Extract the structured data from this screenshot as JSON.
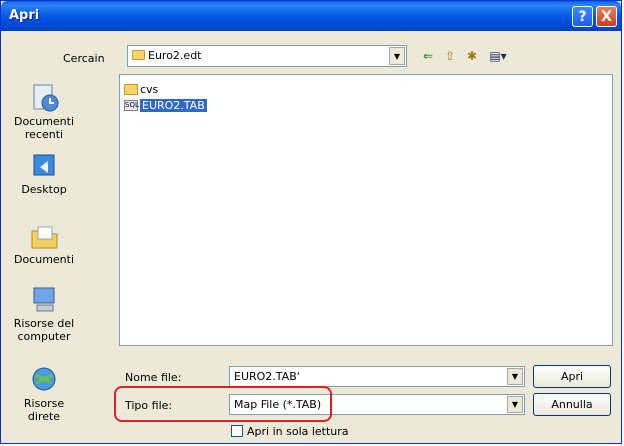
{
  "window": {
    "title": "Apri"
  },
  "titlebar": {
    "help": "?",
    "close": "X"
  },
  "lookin": {
    "label": "Cercain",
    "value": "Euro2.edt"
  },
  "toolbar": {
    "back": "⇐",
    "up": "⇧",
    "new_folder": "✱",
    "views": "▤▾"
  },
  "places": [
    {
      "label": "Documenti recenti"
    },
    {
      "label": "Desktop"
    },
    {
      "label": "Documenti"
    },
    {
      "label": "Risorse del computer"
    },
    {
      "label": "Risorse direte"
    }
  ],
  "files": [
    {
      "name": "cvs",
      "type": "folder"
    },
    {
      "name": "EURO2.TAB",
      "type": "tab",
      "selected": true,
      "badge": "SQL"
    }
  ],
  "filename": {
    "label": "Nome file:",
    "value": "EURO2.TAB'"
  },
  "filetype": {
    "label": "Tipo file:",
    "value": "Map File (*.TAB)"
  },
  "readonly": {
    "label": "Apri in sola lettura"
  },
  "buttons": {
    "open": "Apri",
    "cancel": "Annulla"
  },
  "colors": {
    "titlebar": "#0055e5",
    "selection": "#316ac5",
    "highlight": "#e02020"
  }
}
